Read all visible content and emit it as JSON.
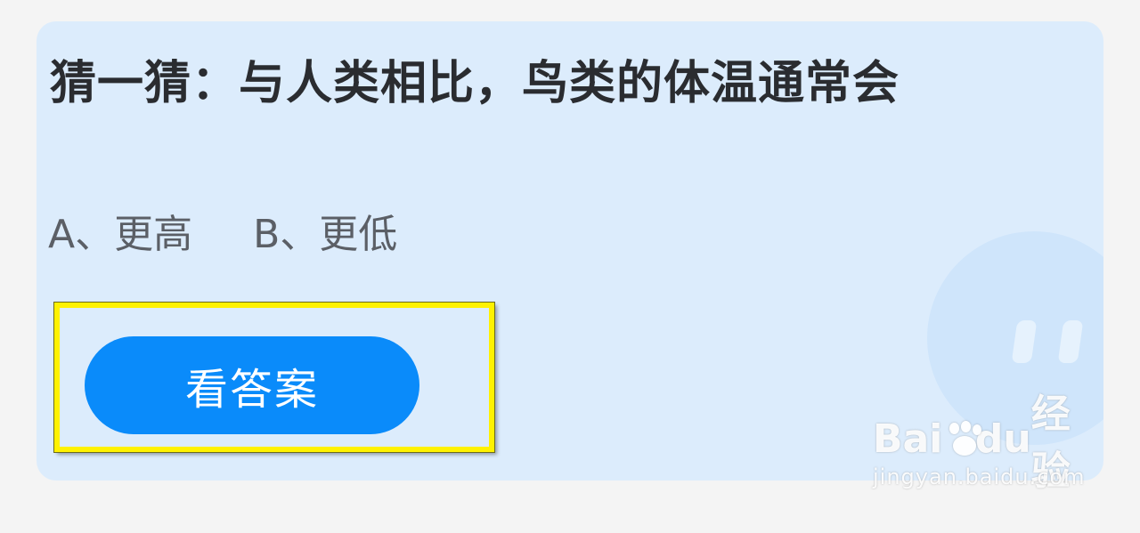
{
  "quiz": {
    "question": "猜一猜：与人类相比，鸟类的体温通常会",
    "options": [
      "A、更高",
      "B、更低"
    ],
    "answer_button_label": "看答案"
  },
  "watermark": {
    "brand_left": "Bai",
    "brand_right": "经验",
    "brand_mid": "du",
    "url": "jingyan.baidu.com"
  },
  "colors": {
    "card_background": "#dcecfc",
    "button": "#0a8bfa",
    "highlight": "#fff200"
  }
}
